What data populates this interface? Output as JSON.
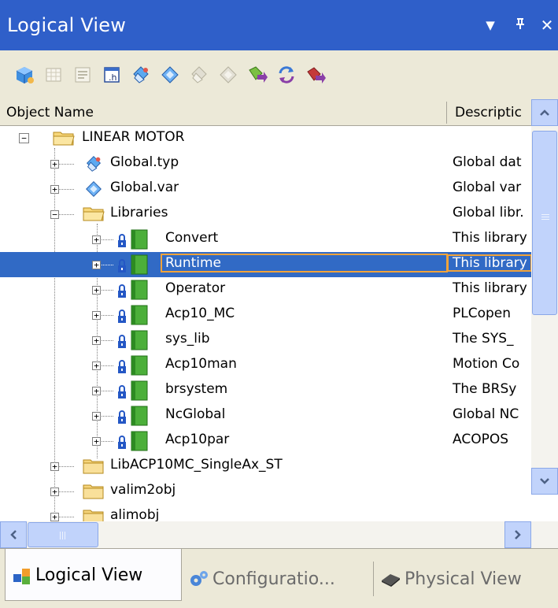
{
  "window": {
    "title": "Logical View",
    "menu_glyph": "▼",
    "pin_glyph": "ᵖ",
    "close_glyph": "✕"
  },
  "toolbar": {
    "icons": [
      "project-cube-icon",
      "grid-icon",
      "form-icon",
      "variable-view-icon",
      "datatype-icon",
      "var-file-icon",
      "datatype-disabled-icon",
      "var-file-disabled-icon",
      "add-object-icon",
      "refresh-icon",
      "remove-object-icon"
    ]
  },
  "columns": {
    "name": "Object Name",
    "description": "Descriptic"
  },
  "tree": {
    "rows": [
      {
        "name": "LINEAR MOTOR",
        "desc": "",
        "icon": "folder-open-icon"
      },
      {
        "name": "Global.typ",
        "desc": "Global dat",
        "icon": "datatype-icon"
      },
      {
        "name": "Global.var",
        "desc": "Global var",
        "icon": "var-file-icon"
      },
      {
        "name": "Libraries",
        "desc": "Global libr.",
        "icon": "folder-open-icon"
      },
      {
        "name": "Convert",
        "desc": "This library",
        "icon": "library-icon"
      },
      {
        "name": "Runtime",
        "desc": "This library",
        "icon": "library-icon"
      },
      {
        "name": "Operator",
        "desc": "This library",
        "icon": "library-icon"
      },
      {
        "name": "Acp10_MC",
        "desc": "PLCopen",
        "icon": "library-icon"
      },
      {
        "name": "sys_lib",
        "desc": "The SYS_",
        "icon": "library-icon"
      },
      {
        "name": "Acp10man",
        "desc": "Motion Co",
        "icon": "library-icon"
      },
      {
        "name": "brsystem",
        "desc": "The BRSy",
        "icon": "library-icon"
      },
      {
        "name": "NcGlobal",
        "desc": "Global NC",
        "icon": "library-icon"
      },
      {
        "name": "Acp10par",
        "desc": "ACOPOS",
        "icon": "library-icon"
      },
      {
        "name": "LibACP10MC_SingleAx_ST",
        "desc": "",
        "icon": "folder-icon"
      },
      {
        "name": "valim2obj",
        "desc": "",
        "icon": "folder-icon"
      },
      {
        "name": "alimobj",
        "desc": "",
        "icon": "folder-icon"
      }
    ],
    "selected": "Runtime"
  },
  "tabs": {
    "logical": "Logical View",
    "configuration": "Configuratio...",
    "physical": "Physical View"
  },
  "colors": {
    "title_bar": "#2f5fc9",
    "selection": "#316ac5",
    "focus_outline": "#f2a33a",
    "chrome": "#ece9d8"
  }
}
